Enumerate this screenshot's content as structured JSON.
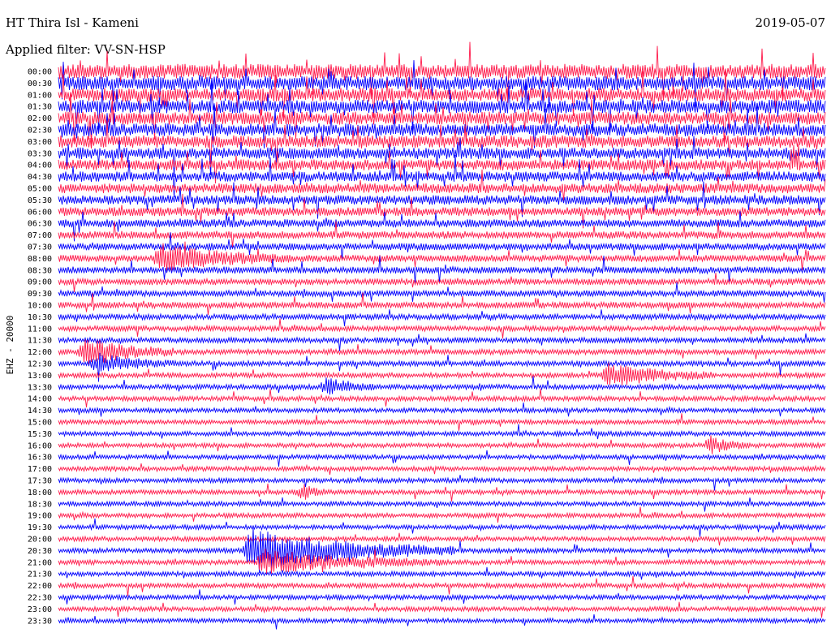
{
  "header": {
    "station": "HT Thira Isl - Kameni",
    "date": "2019-05-07",
    "filter": "Applied filter: VV-SN-HSP"
  },
  "chart_data": {
    "type": "line",
    "title": "HT Thira Isl - Kameni",
    "channel_label": "EHZ - 20000",
    "row_labels": [
      "00:00",
      "00:30",
      "01:00",
      "01:30",
      "02:00",
      "02:30",
      "03:00",
      "03:30",
      "04:00",
      "04:30",
      "05:00",
      "05:30",
      "06:00",
      "06:30",
      "07:00",
      "07:30",
      "08:00",
      "08:30",
      "09:00",
      "09:30",
      "10:00",
      "10:30",
      "11:00",
      "11:30",
      "12:00",
      "12:30",
      "13:00",
      "13:30",
      "14:00",
      "14:30",
      "15:00",
      "15:30",
      "16:00",
      "16:30",
      "17:00",
      "17:30",
      "18:00",
      "18:30",
      "19:00",
      "19:30",
      "20:00",
      "20:30",
      "21:00",
      "21:30",
      "22:00",
      "22:30",
      "23:00",
      "23:30"
    ],
    "series_colors": [
      "#ff1a4b",
      "#0000ff"
    ],
    "rows": 48,
    "minutes_per_row": 30,
    "noise_level": [
      2.2,
      2.1,
      2.0,
      2.0,
      1.9,
      1.9,
      1.8,
      1.7,
      1.6,
      1.5,
      1.45,
      1.4,
      1.3,
      1.2,
      1.1,
      1.05,
      1.0,
      1.0,
      0.95,
      0.9,
      0.9,
      0.85,
      0.8,
      0.8,
      0.8,
      0.78,
      0.75,
      0.75,
      0.72,
      0.7,
      0.7,
      0.7,
      0.7,
      0.7,
      0.7,
      0.7,
      0.7,
      0.7,
      0.7,
      0.7,
      0.7,
      0.72,
      0.72,
      0.72,
      0.72,
      0.7,
      0.7,
      0.7
    ],
    "events": [
      {
        "row": 16,
        "minute": 4.0,
        "amplitude": 1.8,
        "duration": 5.0
      },
      {
        "row": 24,
        "minute": 1.0,
        "amplitude": 2.0,
        "duration": 3.5
      },
      {
        "row": 25,
        "minute": 1.5,
        "amplitude": 1.2,
        "duration": 3.0
      },
      {
        "row": 26,
        "minute": 21.5,
        "amplitude": 1.5,
        "duration": 4.0
      },
      {
        "row": 27,
        "minute": 10.5,
        "amplitude": 1.2,
        "duration": 2.0
      },
      {
        "row": 32,
        "minute": 25.5,
        "amplitude": 1.2,
        "duration": 1.5
      },
      {
        "row": 36,
        "minute": 9.5,
        "amplitude": 1.0,
        "duration": 1.0
      },
      {
        "row": 41,
        "minute": 7.5,
        "amplitude": 3.0,
        "duration": 8.0
      },
      {
        "row": 42,
        "minute": 8.0,
        "amplitude": 1.6,
        "duration": 7.0
      }
    ]
  }
}
